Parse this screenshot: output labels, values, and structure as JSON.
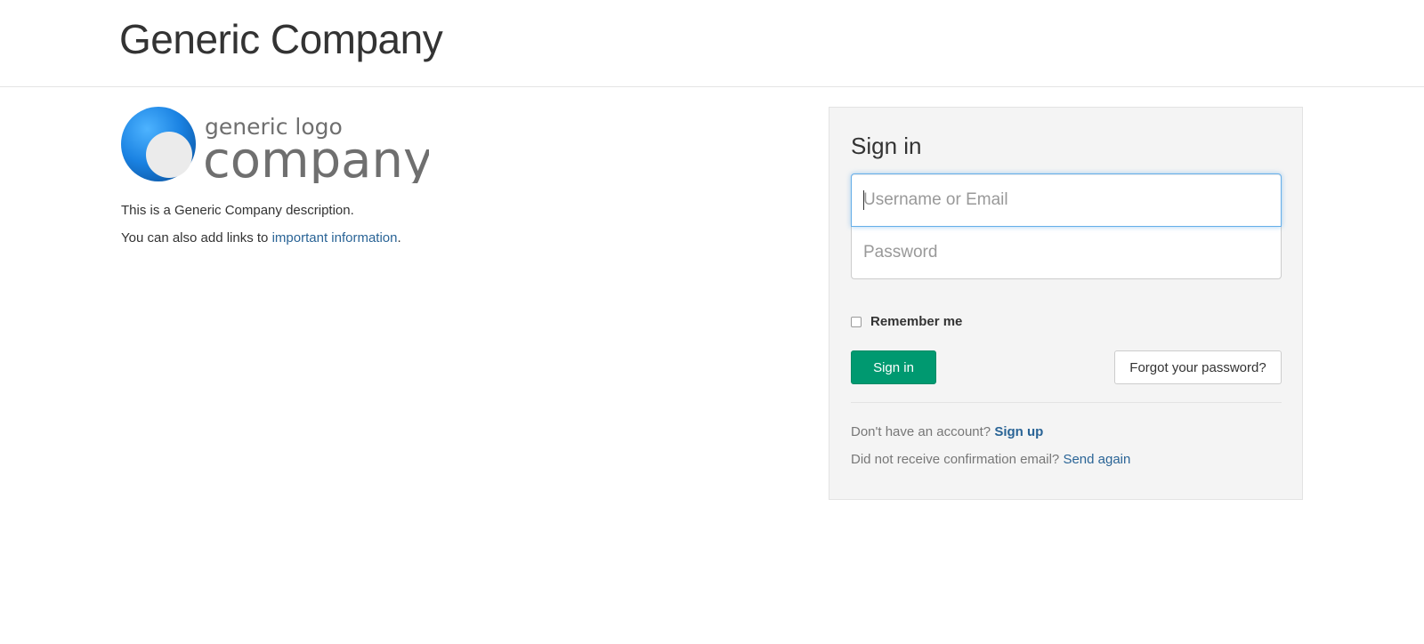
{
  "header": {
    "title": "Generic Company"
  },
  "logo": {
    "line1": "generic logo",
    "line2": "company",
    "circle_color": "#1a82e2"
  },
  "description": {
    "line1": "This is a Generic Company description.",
    "line2_prefix": "You can also add links to ",
    "line2_link": "important information",
    "line2_suffix": "."
  },
  "signin": {
    "title": "Sign in",
    "username_placeholder": "Username or Email",
    "password_placeholder": "Password",
    "remember_label": "Remember me",
    "submit_label": "Sign in",
    "forgot_label": "Forgot your password?",
    "signup_prompt": "Don't have an account? ",
    "signup_link": "Sign up",
    "confirm_prompt": "Did not receive confirmation email? ",
    "confirm_link": "Send again"
  },
  "colors": {
    "primary_button": "#009970",
    "link": "#2a6496",
    "panel_bg": "#f4f4f4"
  }
}
